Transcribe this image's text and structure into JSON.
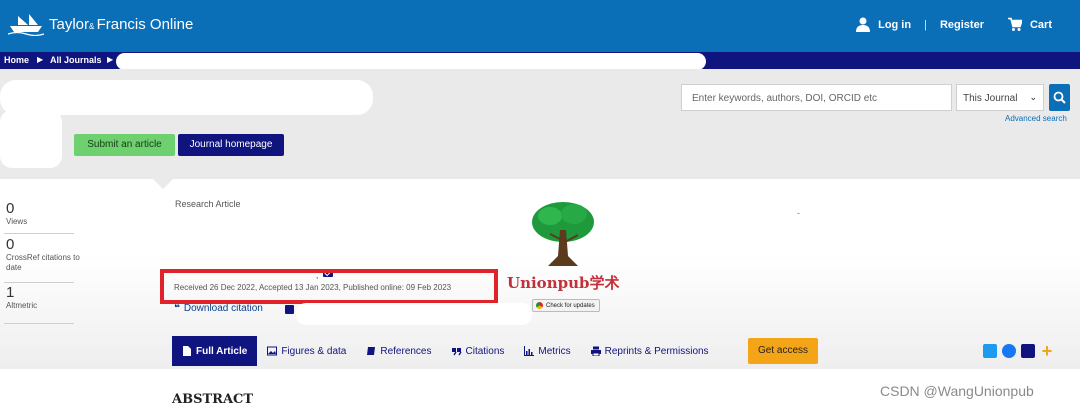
{
  "header": {
    "logo_text": "Taylor",
    "logo_amp": "& ",
    "logo_text2": "Francis Online",
    "login": "Log in",
    "register": "Register",
    "cart": "Cart"
  },
  "breadcrumb": {
    "home": "Home",
    "all_journals": "All Journals"
  },
  "search": {
    "placeholder": "Enter keywords, authors, DOI, ORCID etc",
    "scope": "This Journal",
    "advanced": "Advanced search"
  },
  "journal_buttons": {
    "submit": "Submit an article",
    "homepage": "Journal homepage"
  },
  "metrics": [
    {
      "value": "0",
      "label": "Views"
    },
    {
      "value": "0",
      "label": "CrossRef citations to date"
    },
    {
      "value": "1",
      "label": "Altmetric"
    }
  ],
  "article": {
    "type": "Research Article",
    "dash": "-",
    "dates": "Received 26 Dec 2022, Accepted 13 Jan 2023, Published online: 09 Feb 2023",
    "download_citation": "Download citation",
    "check_updates": "Check for updates"
  },
  "watermark": {
    "text": "Unionpub学术"
  },
  "tabs": [
    {
      "label": "Full Article",
      "icon": "document-icon"
    },
    {
      "label": "Figures & data",
      "icon": "image-icon"
    },
    {
      "label": "References",
      "icon": "book-icon"
    },
    {
      "label": "Citations",
      "icon": "quote-icon"
    },
    {
      "label": "Metrics",
      "icon": "bar-chart-icon"
    },
    {
      "label": "Reprints & Permissions",
      "icon": "printer-icon"
    }
  ],
  "get_access": "Get access",
  "share_icons": [
    "twitter-icon",
    "facebook-icon",
    "email-icon",
    "plus-icon"
  ],
  "section": {
    "abstract": "ABSTRACT"
  },
  "csdn_watermark": "CSDN @WangUnionpub",
  "colors": {
    "brand_blue": "#0b6fb8",
    "navy": "#10147e",
    "submit_green": "#6ed06f",
    "access_orange": "#f4a417",
    "highlight_red": "#e0222a"
  }
}
